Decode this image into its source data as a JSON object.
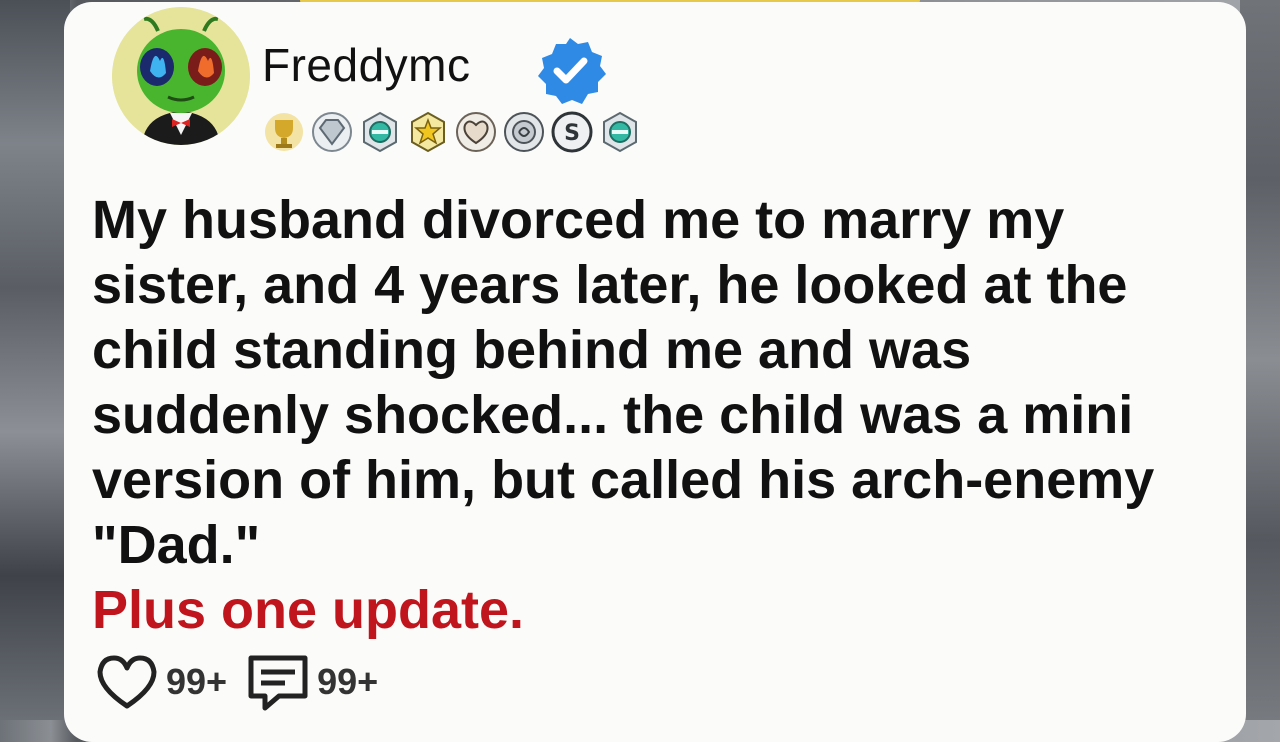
{
  "post": {
    "username": "Freddymc",
    "verified": true,
    "text": "My husband divorced me to marry my sister, and 4 years later, he looked at the child standing behind me and was suddenly shocked... the child was a mini version of him, but called his arch-enemy \"Dad.\"",
    "update_text": "Plus one update."
  },
  "actions": {
    "likes_count": "99+",
    "comments_count": "99+"
  },
  "icons": {
    "avatar": "alien-avatar-icon",
    "verified": "verified-check-icon",
    "like": "heart-icon",
    "comment": "comment-icon",
    "badges": [
      "trophy-badge-icon",
      "diamond-badge-icon",
      "gem-badge-icon",
      "star-badge-icon",
      "heart-badge-icon",
      "rank-badge-icon",
      "coin-badge-icon",
      "gem-badge-icon"
    ]
  },
  "colors": {
    "accent_blue": "#2f8ae6",
    "update_red": "#c0151d",
    "card_bg": "#fbfbfa"
  }
}
